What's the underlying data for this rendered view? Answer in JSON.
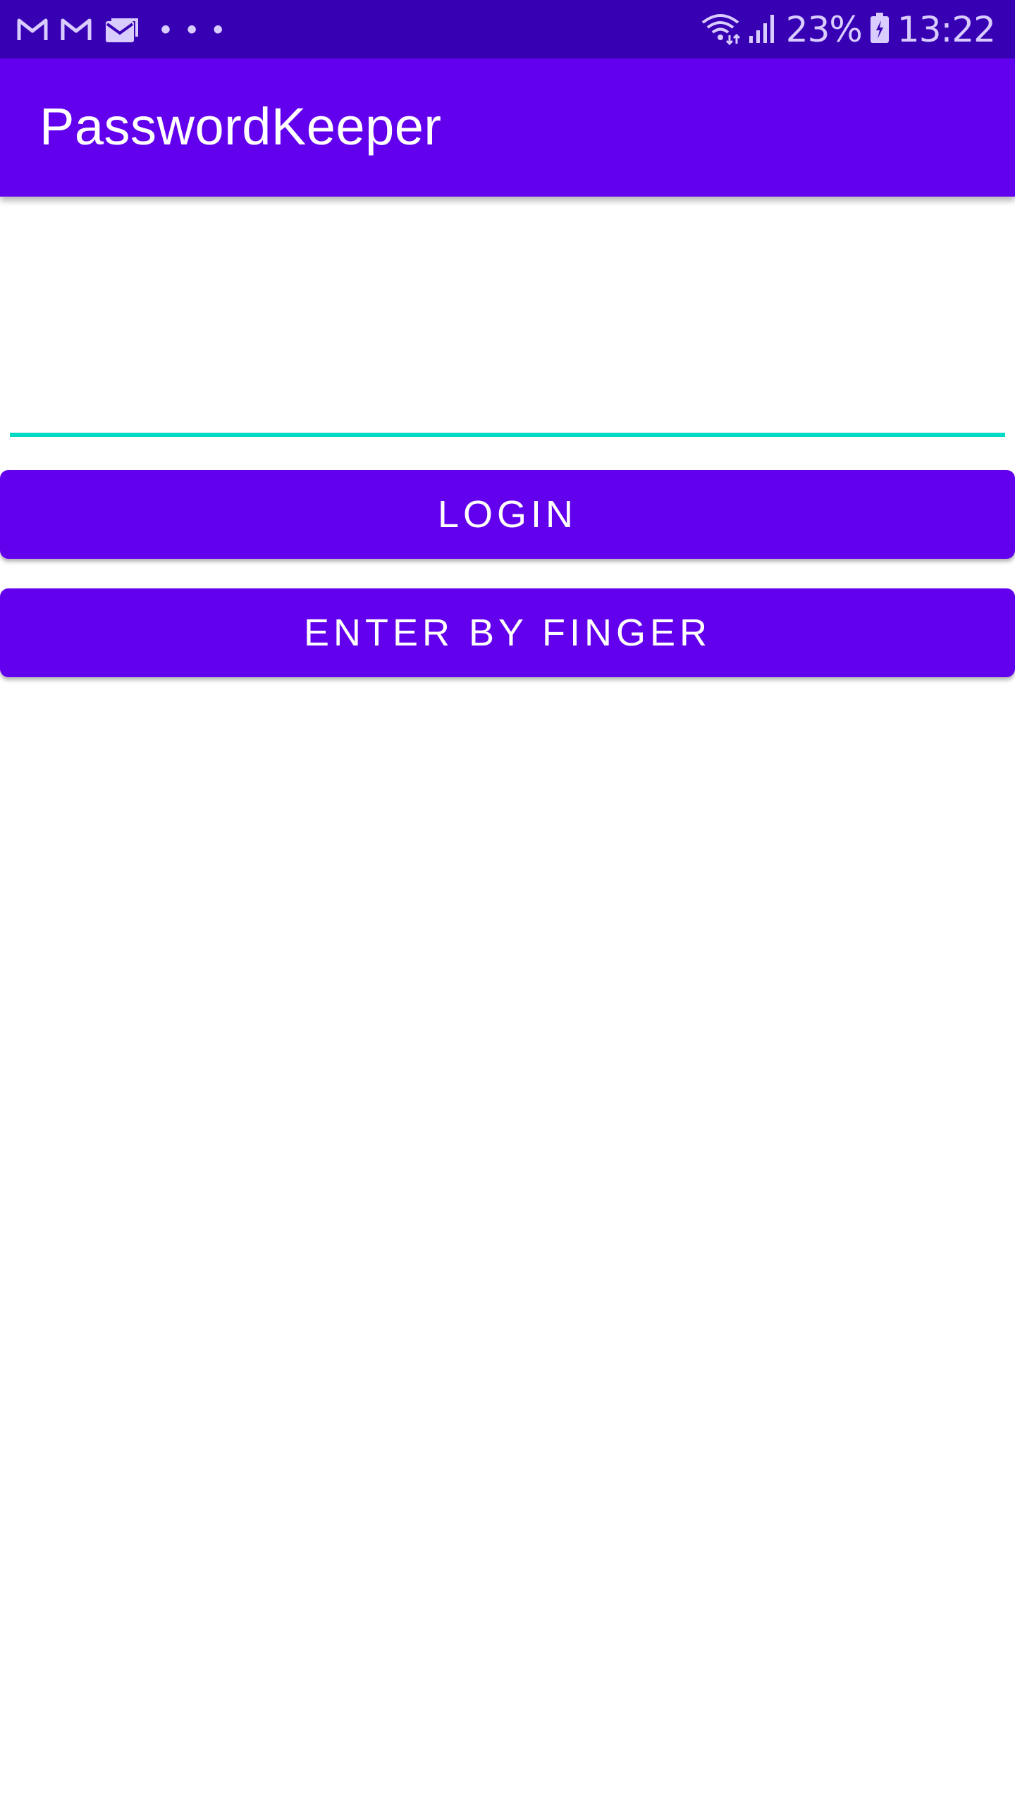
{
  "status_bar": {
    "left_icons": [
      "gmail-icon",
      "gmail-icon",
      "email-icon"
    ],
    "more_indicator": "• • •",
    "battery_percent": "23%",
    "time": "13:22",
    "right_icons": [
      "wifi-icon",
      "signal-icon",
      "battery-charging-icon"
    ]
  },
  "app_bar": {
    "title": "PasswordKeeper"
  },
  "login_form": {
    "password_value": "",
    "login_label": "LOGIN",
    "finger_label": "ENTER BY FINGER"
  },
  "colors": {
    "primary": "#6200ee",
    "primary_dark": "#3700b3",
    "accent": "#03dac5",
    "on_primary": "#ffffff"
  }
}
